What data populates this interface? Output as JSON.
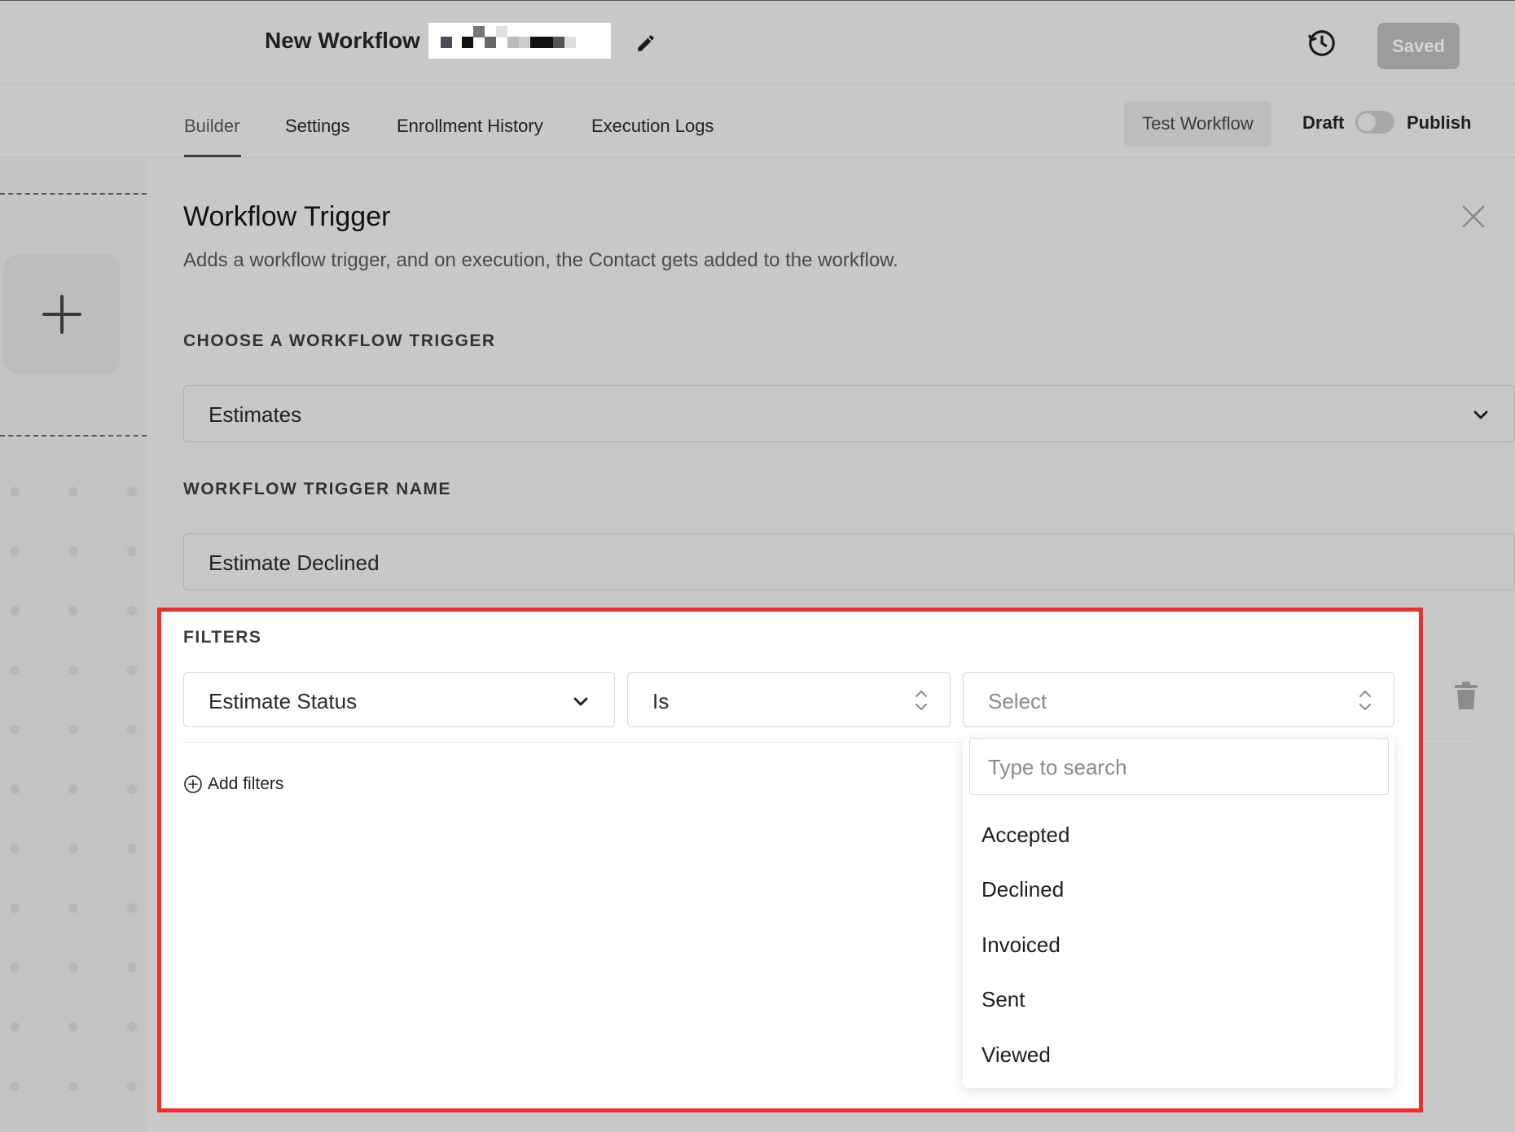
{
  "header": {
    "title": "New Workflow :",
    "saved_label": "Saved"
  },
  "tabs": [
    {
      "label": "Builder",
      "active": true
    },
    {
      "label": "Settings",
      "active": false
    },
    {
      "label": "Enrollment History",
      "active": false
    },
    {
      "label": "Execution Logs",
      "active": false
    }
  ],
  "actions": {
    "test_label": "Test Workflow",
    "draft_label": "Draft",
    "publish_label": "Publish",
    "published": false
  },
  "panel": {
    "title": "Workflow Trigger",
    "description": "Adds a workflow trigger, and on execution, the Contact gets added to the workflow.",
    "trigger_section_label": "CHOOSE A WORKFLOW TRIGGER",
    "trigger_value": "Estimates",
    "name_section_label": "WORKFLOW TRIGGER NAME",
    "name_value": "Estimate Declined"
  },
  "filters": {
    "label": "FILTERS",
    "field_value": "Estimate Status",
    "operator_value": "Is",
    "value_placeholder": "Select",
    "add_label": "Add filters",
    "dropdown": {
      "search_placeholder": "Type to search",
      "options": [
        "Accepted",
        "Declined",
        "Invoiced",
        "Sent",
        "Viewed"
      ]
    }
  },
  "icons": {
    "edit": "pencil-icon",
    "history": "history-icon",
    "close": "close-icon",
    "add_node": "plus-icon",
    "delete": "trash-icon",
    "chevron": "chevron-down-icon",
    "updown": "updown-chevron-icon",
    "add_filter": "plus-circle-icon"
  },
  "colors": {
    "highlight_border": "#ea2e2a",
    "overlay_gray": "#c8c8c8"
  }
}
